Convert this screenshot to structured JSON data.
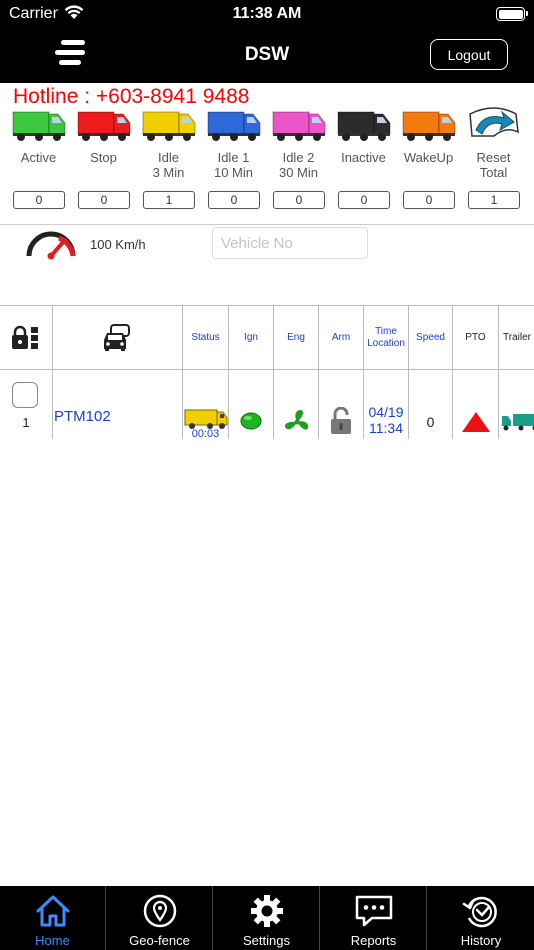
{
  "status_bar": {
    "carrier": "Carrier",
    "time": "11:38 AM"
  },
  "nav": {
    "title": "DSW",
    "logout_label": "Logout"
  },
  "hotline": "Hotline : +603-8941 9488",
  "legend": [
    {
      "label": "Active",
      "count": "0",
      "color": "#3cc83c"
    },
    {
      "label": "Stop",
      "count": "0",
      "color": "#ee1c1c"
    },
    {
      "label": "Idle\n3 Min",
      "count": "1",
      "color": "#f2d000"
    },
    {
      "label": "Idle 1\n10 Min",
      "count": "0",
      "color": "#2f68d8"
    },
    {
      "label": "Idle 2\n30 Min",
      "count": "0",
      "color": "#ee55c8"
    },
    {
      "label": "Inactive",
      "count": "0",
      "color": "#2c2c2c"
    },
    {
      "label": "WakeUp",
      "count": "0",
      "color": "#f47a10"
    },
    {
      "label": "Reset\nTotal",
      "count": "1",
      "icon": "reset-arrow-icon"
    }
  ],
  "speed": {
    "label": "100 Km/h"
  },
  "search": {
    "placeholder": "Vehicle No"
  },
  "table": {
    "headers": {
      "lock": "lock-icon",
      "vehicle": "car-icon",
      "status": "Status",
      "ign": "Ign",
      "eng": "Eng",
      "arm": "Arm",
      "time_location": "Time\nLocation",
      "speed": "Speed",
      "pto": "PTO",
      "trailer": "Trailer"
    },
    "rows": [
      {
        "no": "1",
        "plate": "PTM102",
        "status_time": "00:03",
        "time": "04/19\n11:34",
        "speed": "0"
      }
    ]
  },
  "tabs": [
    {
      "label": "Home",
      "icon": "home-icon",
      "active": true
    },
    {
      "label": "Geo-fence",
      "icon": "geo-fence-icon",
      "active": false
    },
    {
      "label": "Settings",
      "icon": "gear-icon",
      "active": false
    },
    {
      "label": "Reports",
      "icon": "chat-icon",
      "active": false
    },
    {
      "label": "History",
      "icon": "history-icon",
      "active": false
    }
  ],
  "colors": {
    "accent": "#3d8bff",
    "link": "#1a3fd6",
    "hotline": "#ff0000"
  }
}
